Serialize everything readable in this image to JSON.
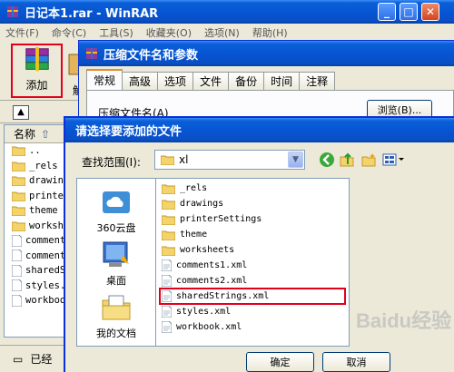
{
  "winrar": {
    "title": "日记本1.rar - WinRAR",
    "menu": [
      "文件(F)",
      "命令(C)",
      "工具(S)",
      "收藏夹(O)",
      "选项(N)",
      "帮助(H)"
    ],
    "toolbar": {
      "add_label": "添加",
      "extract_label": "解"
    },
    "filelist": {
      "col_name": "名称",
      "rows": [
        "..",
        "_rels",
        "drawing",
        "printer",
        "theme",
        "workshe",
        "comment",
        "comment",
        "sharedS",
        "styles.",
        "workboo"
      ]
    },
    "status": {
      "text": "已经"
    }
  },
  "archive_dialog": {
    "title": "压缩文件名和参数",
    "tabs": [
      "常规",
      "高级",
      "选项",
      "文件",
      "备份",
      "时间",
      "注释"
    ],
    "archive_name_label": "压缩文件名(A)",
    "browse_label": "浏览(B)..."
  },
  "select_dialog": {
    "title": "请选择要添加的文件",
    "look_in_label": "查找范围(I):",
    "look_in_value": "xl",
    "places": [
      {
        "label": "360云盘",
        "icon": "cloud-drive-icon"
      },
      {
        "label": "桌面",
        "icon": "desktop-icon"
      },
      {
        "label": "我的文档",
        "icon": "my-documents-icon"
      }
    ],
    "items": [
      {
        "name": "_rels",
        "kind": "folder"
      },
      {
        "name": "drawings",
        "kind": "folder"
      },
      {
        "name": "printerSettings",
        "kind": "folder"
      },
      {
        "name": "theme",
        "kind": "folder"
      },
      {
        "name": "worksheets",
        "kind": "folder"
      },
      {
        "name": "comments1.xml",
        "kind": "file"
      },
      {
        "name": "comments2.xml",
        "kind": "file"
      },
      {
        "name": "sharedStrings.xml",
        "kind": "file",
        "highlight": true
      },
      {
        "name": "styles.xml",
        "kind": "file"
      },
      {
        "name": "workbook.xml",
        "kind": "file"
      }
    ],
    "ok_label": "确定",
    "cancel_label": "取消"
  },
  "watermark": "Baidu经验",
  "colors": {
    "xp_blue": "#0654d2",
    "highlight_red": "#e4001b",
    "window_bg": "#ece9d8"
  }
}
